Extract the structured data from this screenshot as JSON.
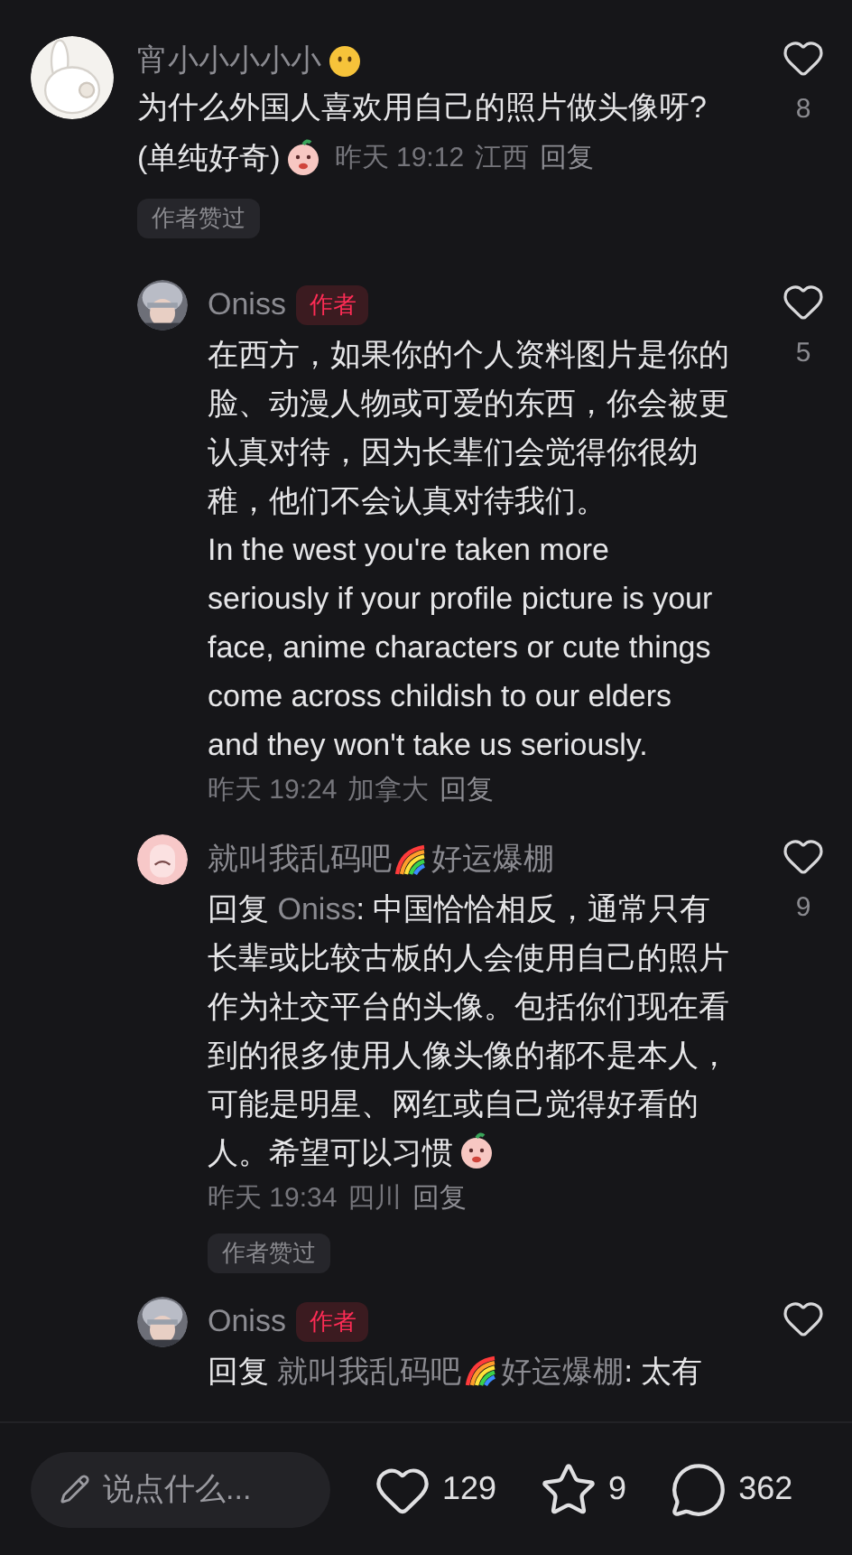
{
  "comments": [
    {
      "name_parts": [
        "宵小小小小小"
      ],
      "name_emoji": true,
      "paragraphs": [
        "为什么外国人喜欢用自己的照片做头像呀?",
        "(单纯好奇)"
      ],
      "text_sticker": true,
      "meta_inline": true,
      "time": "昨天 19:12",
      "location": "江西",
      "reply": "回复",
      "likes": "8",
      "author_liked": "作者赞过",
      "children": [
        {
          "name_parts": [
            "Oniss"
          ],
          "badge": "作者",
          "paragraphs": [
            "在西方，如果你的个人资料图片是你的脸、动漫人物或可爱的东西，你会被更认真对待，因为长辈们会觉得你很幼稚，他们不会认真对待我们。",
            "In the west you're taken more seriously if your profile picture is your face, anime characters or cute things come across childish to our elders and they won't take us seriously."
          ],
          "time": "昨天 19:24",
          "location": "加拿大",
          "reply": "回复",
          "likes": "5"
        },
        {
          "name_parts": [
            "就叫我乱码吧",
            "好运爆棚"
          ],
          "reply_label": "回复",
          "reply_to": [
            "Oniss"
          ],
          "paragraphs": [
            ": 中国恰恰相反，通常只有长辈或比较古板的人会使用自己的照片作为社交平台的头像。包括你们现在看到的很多使用人像头像的都不是本人，可能是明星、网红或自己觉得好看的人。希望可以习惯"
          ],
          "text_sticker": true,
          "time": "昨天 19:34",
          "location": "四川",
          "reply": "回复",
          "likes": "9",
          "author_liked": "作者赞过"
        },
        {
          "name_parts": [
            "Oniss"
          ],
          "badge": "作者",
          "reply_label": "回复",
          "reply_to": [
            "就叫我乱码吧",
            "好运爆棚"
          ],
          "paragraphs": [
            ": 太有"
          ]
        }
      ]
    }
  ],
  "bottom_bar": {
    "placeholder": "说点什么...",
    "likes": "129",
    "favorites": "9",
    "comments": "362"
  }
}
